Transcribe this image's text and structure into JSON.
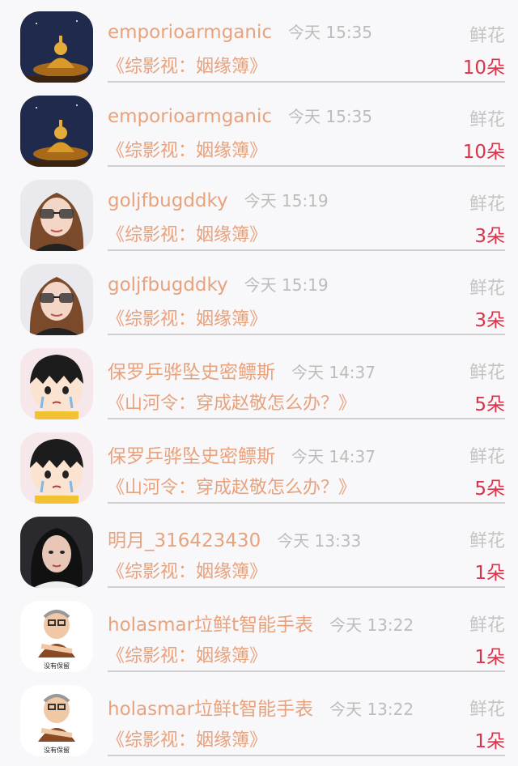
{
  "gift_label": "鲜花",
  "rows": [
    {
      "name": "emporioarmganic",
      "time": "今天 15:35",
      "title": "《综影视：姻缘簿》",
      "count": "10朵",
      "avatar": "golden-buddha-statue-night"
    },
    {
      "name": "emporioarmganic",
      "time": "今天 15:35",
      "title": "《综影视：姻缘簿》",
      "count": "10朵",
      "avatar": "golden-buddha-statue-night"
    },
    {
      "name": "goljfbugddky",
      "time": "今天 15:19",
      "title": "《综影视：姻缘簿》",
      "count": "3朵",
      "avatar": "woman-with-sunglasses"
    },
    {
      "name": "goljfbugddky",
      "time": "今天 15:19",
      "title": "《综影视：姻缘簿》",
      "count": "3朵",
      "avatar": "woman-with-sunglasses"
    },
    {
      "name": "保罗乒骅坠史密鳔斯",
      "time": "今天 14:37",
      "title": "《山河令：穿成赵敬怎么办？》",
      "count": "5朵",
      "avatar": "cartoon-girl-crying"
    },
    {
      "name": "保罗乒骅坠史密鳔斯",
      "time": "今天 14:37",
      "title": "《山河令：穿成赵敬怎么办？》",
      "count": "5朵",
      "avatar": "cartoon-girl-crying"
    },
    {
      "name": "明月_316423430",
      "time": "今天 13:33",
      "title": "《综影视：姻缘簿》",
      "count": "1朵",
      "avatar": "woman-portrait"
    },
    {
      "name": "holasmar垃鲜t智能手表",
      "time": "今天 13:22",
      "title": "《综影视：姻缘簿》",
      "count": "1朵",
      "avatar": "cartoon-old-man",
      "avatar_caption": "没有保留"
    },
    {
      "name": "holasmar垃鲜t智能手表",
      "time": "今天 13:22",
      "title": "《综影视：姻缘簿》",
      "count": "1朵",
      "avatar": "cartoon-old-man",
      "avatar_caption": "没有保留"
    }
  ]
}
